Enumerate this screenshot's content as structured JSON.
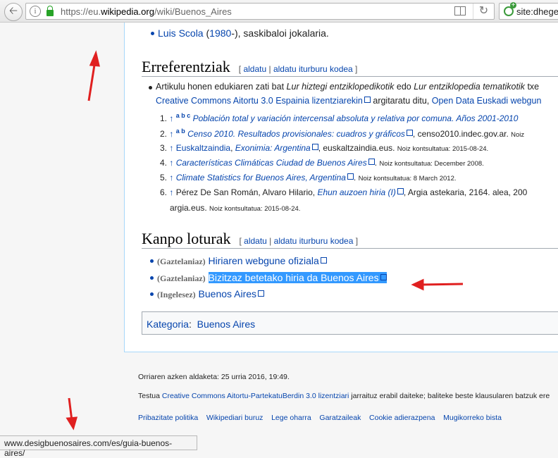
{
  "browser": {
    "url_prefix": "https://eu.",
    "url_domain": "wikipedia.org",
    "url_path": "/wiki/Buenos_Aires",
    "search_text": "site:dhege.",
    "back_glyph": "🡠",
    "info_glyph": "i",
    "reload_glyph": "↻"
  },
  "notable": {
    "name": "Luis Scola",
    "year": "1980",
    "open": " (",
    "close": "-), saskibaloi jokalaria."
  },
  "references": {
    "heading": "Erreferentziak",
    "edit_open": "[ ",
    "edit": "aldatu",
    "sep": " | ",
    "edit_source": "aldatu iturburu kodea",
    "edit_close": " ]",
    "intro_1": "Artikulu honen edukiaren zati bat ",
    "intro_dict": "Lur hiztegi entziklopedikotik",
    "intro_mid": " edo ",
    "intro_enc": "Lur entziklopedia tematikotik",
    "intro_end": " txe",
    "license_link": "Creative Commons Aitortu 3.0 Espainia lizentziarekin",
    "license_mid": " argitaratu ditu, ",
    "open_data": "Open Data Euskadi webgun",
    "items": [
      {
        "num": "1.",
        "up": "↑",
        "letters": "a b c",
        "title": "Población total y variación intercensal absoluta y relativa por comuna. Años 2001-2010",
        "after": "",
        "note": ""
      },
      {
        "num": "2.",
        "up": "↑",
        "letters": "a b",
        "title": "Censo 2010. Resultados provisionales: cuadros y gráficos",
        "after": ", censo2010.indec.gov.ar.",
        "note": "Noiz"
      },
      {
        "num": "3.",
        "up": "↑",
        "pre": "Euskaltzaindia",
        "title": "Exonimia: Argentina",
        "after": ", euskaltzaindia.eus.",
        "note": "Noiz kontsultatua: 2015-08-24."
      },
      {
        "num": "4.",
        "up": "↑",
        "title": "Características Climáticas Ciudad de Buenos Aires",
        "after": ".",
        "note": "Noiz kontsultatua: December 2008."
      },
      {
        "num": "5.",
        "up": "↑",
        "title": "Climate Statistics for Buenos Aires, Argentina",
        "after": ".",
        "note": "Noiz kontsultatua: 8 March 2012."
      },
      {
        "num": "6.",
        "up": "↑",
        "pre": "Pérez De San Román, Alvaro Hilario, ",
        "title": "Ehun auzoen hiria (I)",
        "after": ", Argia astekaria, 2164. alea, 200",
        "line2": "argia.eus.",
        "note": "Noiz kontsultatua: 2015-08-24."
      }
    ]
  },
  "external": {
    "heading": "Kanpo loturak",
    "links": [
      {
        "lang": "(Gaztelaniaz)",
        "text": "Hiriaren webgune ofiziala"
      },
      {
        "lang": "(Gaztelaniaz)",
        "text": "Bizitzaz betetako hiria da Buenos Aires"
      },
      {
        "lang": "(Ingelesez)",
        "text": "Buenos Aires"
      }
    ]
  },
  "category": {
    "label": "Kategoria",
    "colon": ":",
    "value": "Buenos Aires"
  },
  "footer": {
    "last_modified": "Orriaren azken aldaketa: 25 urria 2016, 19:49.",
    "license_pre": "Testua ",
    "license_link": "Creative Commons Aitortu-PartekatuBerdin 3.0 lizentziari",
    "license_post": " jarraituz erabil daiteke; baliteke beste klausularen batzuk ere",
    "links": [
      "Pribazitate politika",
      "Wikipediari buruz",
      "Lege oharra",
      "Garatzaileak",
      "Cookie adierazpena",
      "Mugikorreko bista"
    ]
  },
  "status_url": "www.desigbuenosaires.com/es/guia-buenos-aires/",
  "colors": {
    "link": "#0645ad",
    "highlight": "#3399ff",
    "annotation_arrow": "#e02020"
  }
}
